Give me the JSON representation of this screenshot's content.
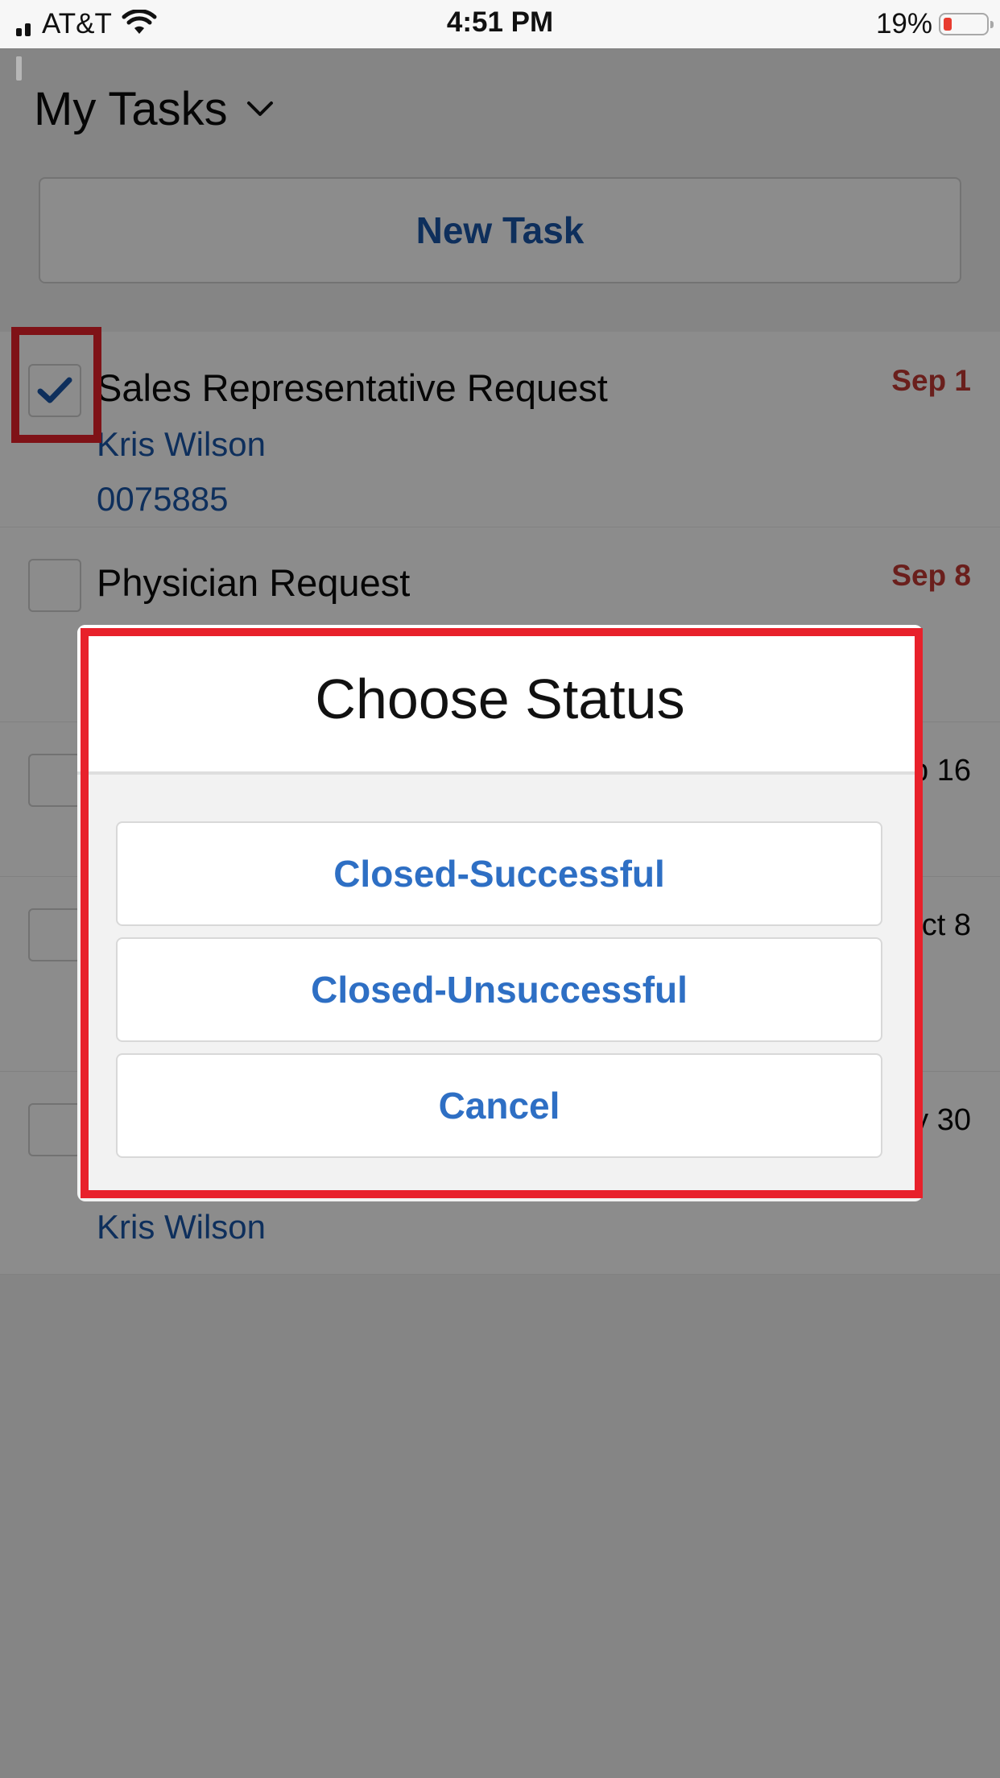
{
  "status_bar": {
    "carrier": "AT&T",
    "time": "4:51 PM",
    "battery_percent": "19%",
    "battery_level": 0.19,
    "icons": [
      "signal-icon",
      "wifi-icon",
      "battery-icon"
    ]
  },
  "header": {
    "title": "My Tasks",
    "new_task_label": "New Task"
  },
  "tasks": [
    {
      "title": "Sales Representative Request",
      "subtitle_1": "Kris Wilson",
      "subtitle_2": "0075885",
      "date": "Sep 1",
      "checked": true
    },
    {
      "title": "Physician Request",
      "subtitle_1": "",
      "subtitle_2": "",
      "date": "Sep 8",
      "checked": false
    },
    {
      "title": "",
      "subtitle_1": "",
      "subtitle_2": "",
      "date": "p 16",
      "checked": false
    },
    {
      "title": "",
      "subtitle_1": "",
      "subtitle_2": "",
      "date": "ct 8",
      "checked": false
    },
    {
      "title": "",
      "subtitle_1": "Kris Wilson",
      "subtitle_2": "",
      "date": "y 30",
      "checked": false
    }
  ],
  "modal": {
    "title": "Choose Status",
    "buttons": {
      "closed_successful": "Closed-Successful",
      "closed_unsuccessful": "Closed-Unsuccessful",
      "cancel": "Cancel"
    }
  },
  "colors": {
    "accent": "#1a56a8",
    "overdue_date": "#c23934",
    "highlight": "#e8212b",
    "modal_button_text": "#2e6fc4"
  }
}
